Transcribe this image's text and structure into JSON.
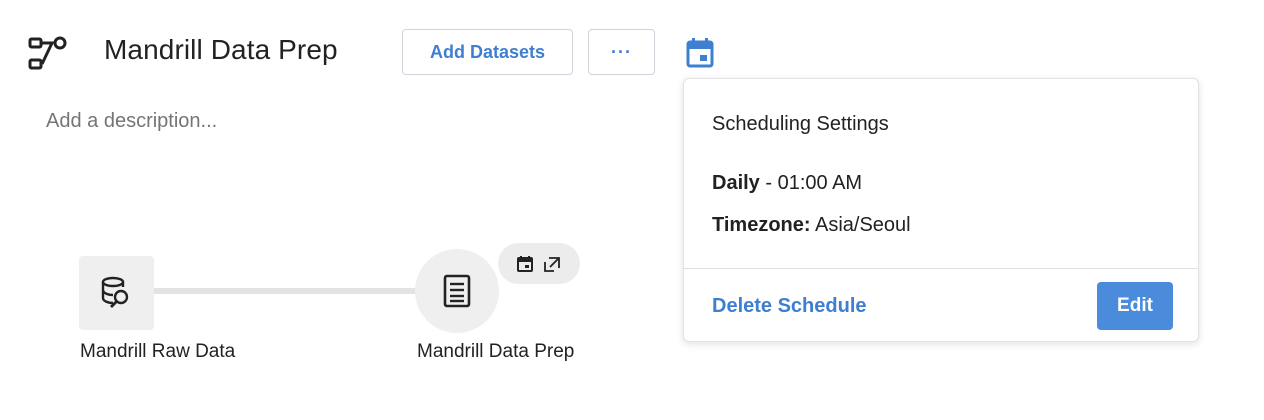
{
  "header": {
    "title": "Mandrill Data Prep",
    "add_datasets_label": "Add Datasets",
    "more_label": "···",
    "flow_icon": "flow-icon",
    "schedule_icon": "calendar-icon"
  },
  "description_placeholder": "Add a description...",
  "flow": {
    "nodes": [
      {
        "label": "Mandrill Raw Data",
        "icon": "database-search-icon"
      },
      {
        "label": "Mandrill Data Prep",
        "icon": "document-list-icon",
        "badges": [
          "calendar-icon",
          "open-external-icon"
        ]
      }
    ]
  },
  "schedule_popover": {
    "title": "Scheduling Settings",
    "frequency_label": "Daily",
    "frequency_value": " - 01:00 AM",
    "timezone_label": "Timezone:",
    "timezone_value": " Asia/Seoul",
    "delete_label": "Delete Schedule",
    "edit_label": "Edit"
  },
  "colors": {
    "accent": "#3e7fd1",
    "button_primary": "#4a8bdb",
    "node_bg": "#efefef",
    "edge": "#e3e3e3",
    "muted_text": "#757575"
  }
}
